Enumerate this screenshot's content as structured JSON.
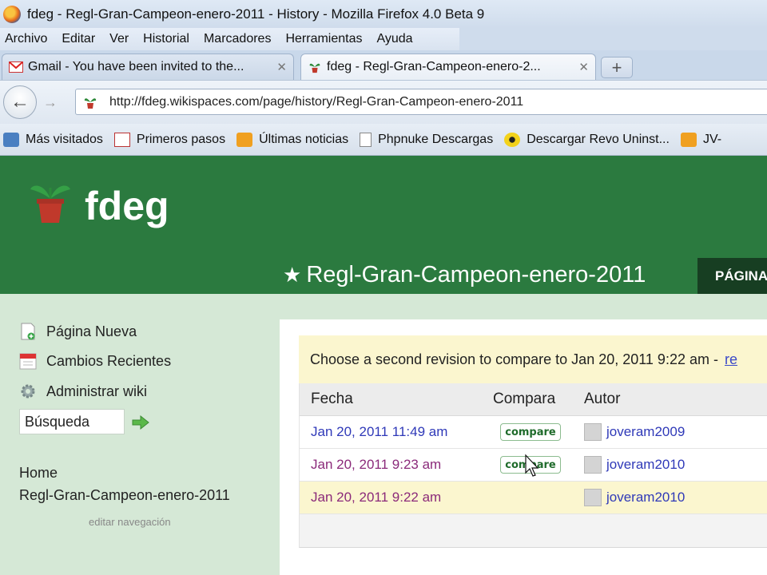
{
  "window": {
    "title": "fdeg - Regl-Gran-Campeon-enero-2011 - History - Mozilla Firefox 4.0 Beta 9"
  },
  "menu": [
    "Archivo",
    "Editar",
    "Ver",
    "Historial",
    "Marcadores",
    "Herramientas",
    "Ayuda"
  ],
  "tabs": [
    {
      "title": "Gmail - You have been invited to the...",
      "close": "✕"
    },
    {
      "title": "fdeg - Regl-Gran-Campeon-enero-2...",
      "close": "✕"
    }
  ],
  "new_tab": "+",
  "url": "http://fdeg.wikispaces.com/page/history/Regl-Gran-Campeon-enero-2011",
  "bookmarks": [
    "Más visitados",
    "Primeros pasos",
    "Últimas noticias",
    "Phpnuke Descargas",
    "Descargar Revo Uninst...",
    "JV-"
  ],
  "wiki": {
    "name": "fdeg",
    "page_title": "Regl-Gran-Campeon-enero-2011",
    "star": "★",
    "page_tab": "PÁGINA"
  },
  "sidebar": {
    "links": [
      "Página Nueva",
      "Cambios Recientes",
      "Administrar wiki"
    ],
    "search_value": "Búsqueda",
    "nav": [
      "Home",
      "Regl-Gran-Campeon-enero-2011"
    ],
    "edit_nav": "editar navegación"
  },
  "history": {
    "notice": "Choose a second revision to compare to Jan 20, 2011 9:22 am -",
    "notice_link": "re",
    "headers": {
      "fecha": "Fecha",
      "compara": "Compara",
      "autor": "Autor"
    },
    "rows": [
      {
        "date": "Jan 20, 2011 11:49 am",
        "compare": "compare",
        "author": "joveram2009"
      },
      {
        "date": "Jan 20, 2011 9:23 am",
        "compare": "compare",
        "author": "joveram2010"
      },
      {
        "date": "Jan 20, 2011 9:22 am",
        "compare": "",
        "author": "joveram2010"
      }
    ]
  },
  "colors": {
    "wiki_header": "#2b7a3f",
    "sidebar_bg": "#d5e8d6",
    "notice_bg": "#fbf6cf",
    "link": "#2f39b8",
    "visited": "#8b2a7a"
  }
}
